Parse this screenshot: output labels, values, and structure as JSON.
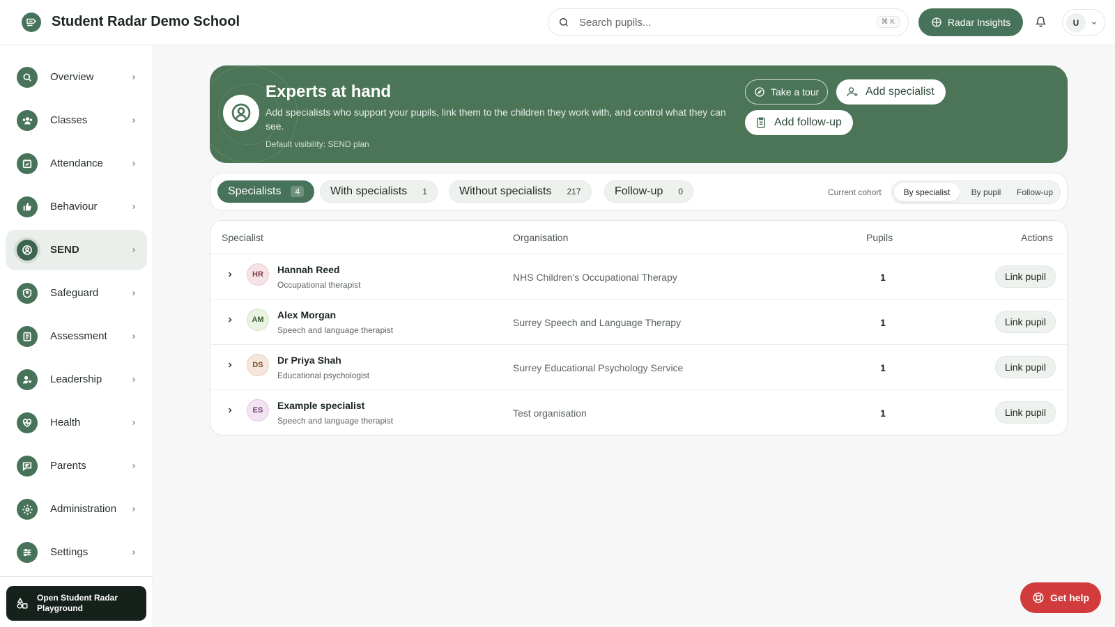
{
  "app": {
    "title": "Student Radar Demo School"
  },
  "header": {
    "search_placeholder": "Search pupils...",
    "search_shortcut": "⌘ K",
    "insights_label": "Radar Insights",
    "user_initial": "U"
  },
  "sidebar": {
    "items": [
      {
        "label": "Overview",
        "icon": "search-icon"
      },
      {
        "label": "Classes",
        "icon": "users-icon"
      },
      {
        "label": "Attendance",
        "icon": "calendar-check-icon"
      },
      {
        "label": "Behaviour",
        "icon": "thumbs-up-icon"
      },
      {
        "label": "SEND",
        "icon": "user-circle-icon",
        "active": true
      },
      {
        "label": "Safeguard",
        "icon": "shield-user-icon"
      },
      {
        "label": "Assessment",
        "icon": "clipboard-icon"
      },
      {
        "label": "Leadership",
        "icon": "user-star-icon"
      },
      {
        "label": "Health",
        "icon": "heart-pulse-icon"
      },
      {
        "label": "Parents",
        "icon": "message-icon"
      },
      {
        "label": "Administration",
        "icon": "gear-icon"
      },
      {
        "label": "Settings",
        "icon": "sliders-icon"
      }
    ],
    "playground_label": "Open Student Radar Playground"
  },
  "hero": {
    "title": "Experts at hand",
    "description": "Add specialists who support your pupils, link them to the children they work with, and control what they can see.",
    "visibility": "Default visibility: SEND plan",
    "tour_label": "Take a tour",
    "add_specialist_label": "Add specialist",
    "add_followup_label": "Add follow-up"
  },
  "tabs": [
    {
      "label": "Specialists",
      "count": "4",
      "active": true
    },
    {
      "label": "With specialists",
      "count": "1"
    },
    {
      "label": "Without specialists",
      "count": "217"
    },
    {
      "label": "Follow-up",
      "count": "0"
    }
  ],
  "cohort": {
    "label": "Current cohort",
    "options": [
      "By specialist",
      "By pupil",
      "Follow-up"
    ],
    "selected": "By specialist"
  },
  "table": {
    "columns": [
      "Specialist",
      "Organisation",
      "Pupils",
      "Actions"
    ],
    "rows": [
      {
        "initials": "HR",
        "name": "Hannah Reed",
        "role": "Occupational therapist",
        "organisation": "NHS Children's Occupational Therapy",
        "pupils": "1",
        "action": "Link pupil"
      },
      {
        "initials": "AM",
        "name": "Alex Morgan",
        "role": "Speech and language therapist",
        "organisation": "Surrey Speech and Language Therapy",
        "pupils": "1",
        "action": "Link pupil"
      },
      {
        "initials": "DS",
        "name": "Dr Priya Shah",
        "role": "Educational psychologist",
        "organisation": "Surrey Educational Psychology Service",
        "pupils": "1",
        "action": "Link pupil"
      },
      {
        "initials": "ES",
        "name": "Example specialist",
        "role": "Speech and language therapist",
        "organisation": "Test organisation",
        "pupils": "1",
        "action": "Link pupil"
      }
    ]
  },
  "help": {
    "label": "Get help"
  },
  "colors": {
    "brand": "#47735a",
    "hero": "#4b7556",
    "help": "#d13b3b",
    "avatar_hr": "#f7e3e6",
    "avatar_am": "#e9f3e2",
    "avatar_ds": "#f6e6dc",
    "avatar_es": "#f2e3f2"
  }
}
